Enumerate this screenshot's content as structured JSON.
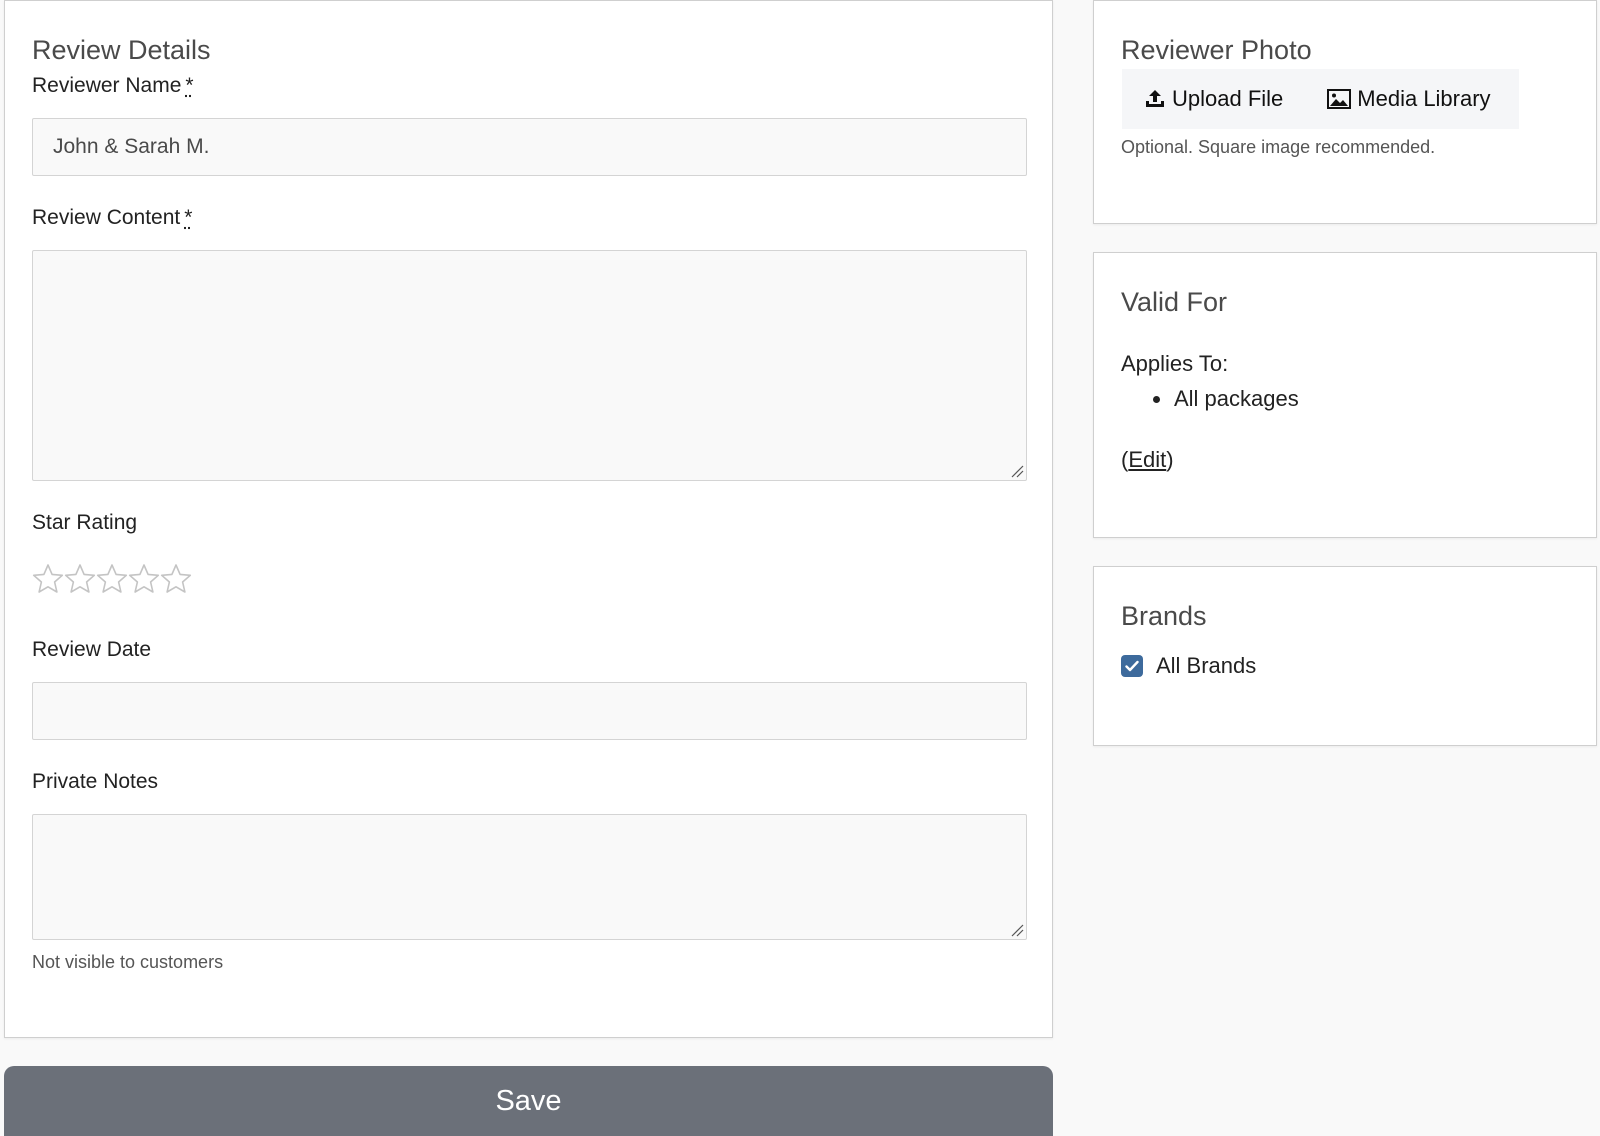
{
  "review_details": {
    "title": "Review Details",
    "reviewer_name": {
      "label": "Reviewer Name",
      "required_marker": "*",
      "value": "John & Sarah M."
    },
    "review_content": {
      "label": "Review Content",
      "required_marker": "*",
      "value": ""
    },
    "star_rating": {
      "label": "Star Rating",
      "max": 5,
      "value": 0,
      "star_color": "#c4c4c4"
    },
    "review_date": {
      "label": "Review Date",
      "value": ""
    },
    "private_notes": {
      "label": "Private Notes",
      "value": "",
      "help": "Not visible to customers"
    }
  },
  "save_button": {
    "label": "Save",
    "color": "#6b7079"
  },
  "reviewer_photo": {
    "title": "Reviewer Photo",
    "upload_label": "Upload File",
    "upload_icon": "upload-icon",
    "media_library_label": "Media Library",
    "media_library_icon": "image-icon",
    "help": "Optional. Square image recommended."
  },
  "valid_for": {
    "title": "Valid For",
    "applies_to_label": "Applies To:",
    "items": [
      "All packages"
    ],
    "edit_open": "(",
    "edit_label": "Edit",
    "edit_close": ")"
  },
  "brands": {
    "title": "Brands",
    "all_brands_label": "All Brands",
    "all_brands_checked": true,
    "checkbox_color": "#3d6a9c"
  }
}
